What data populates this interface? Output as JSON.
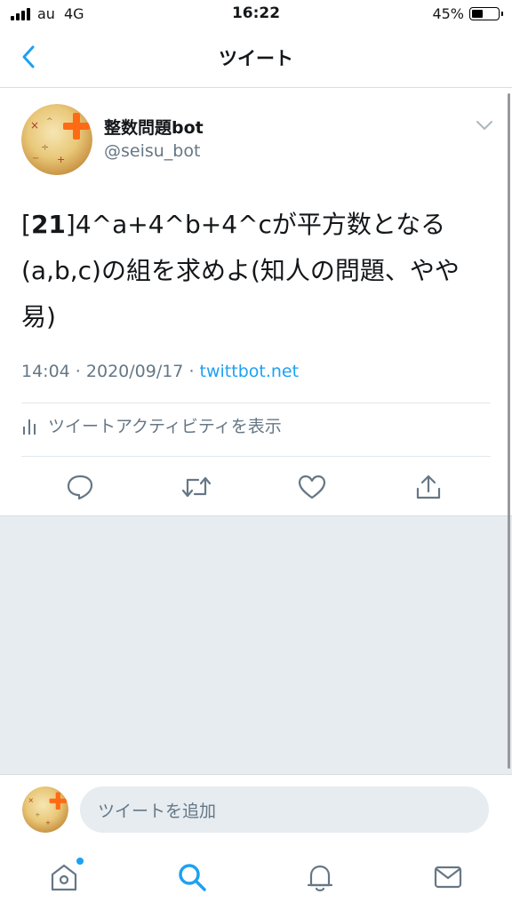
{
  "status_bar": {
    "carrier": "au",
    "network": "4G",
    "time": "16:22",
    "battery": "45%",
    "battery_level": 0.45
  },
  "nav": {
    "title": "ツイート"
  },
  "tweet": {
    "author_name": "整数問題bot",
    "author_handle": "@seisu_bot",
    "text_number": "21",
    "text_prefix": "[",
    "text_suffix": "]",
    "text_body": "4^a+4^b+4^cが平方数となる(a,b,c)の組を求めよ(知人の問題、やや易)",
    "time": "14:04",
    "date": "2020/09/17",
    "source": "twittbot.net",
    "separator": " · ",
    "activity_label": "ツイートアクティビティを表示"
  },
  "reply": {
    "placeholder": "ツイートを追加"
  },
  "colors": {
    "accent": "#1da1f2",
    "secondary_text": "#657786",
    "background_gray": "#e6ecf0"
  },
  "icons": {
    "nav": "back-chevron-icon",
    "actions": [
      "reply-icon",
      "retweet-icon",
      "like-icon",
      "share-icon"
    ],
    "tabs": [
      "home-icon",
      "search-icon",
      "notifications-icon",
      "messages-icon"
    ]
  }
}
